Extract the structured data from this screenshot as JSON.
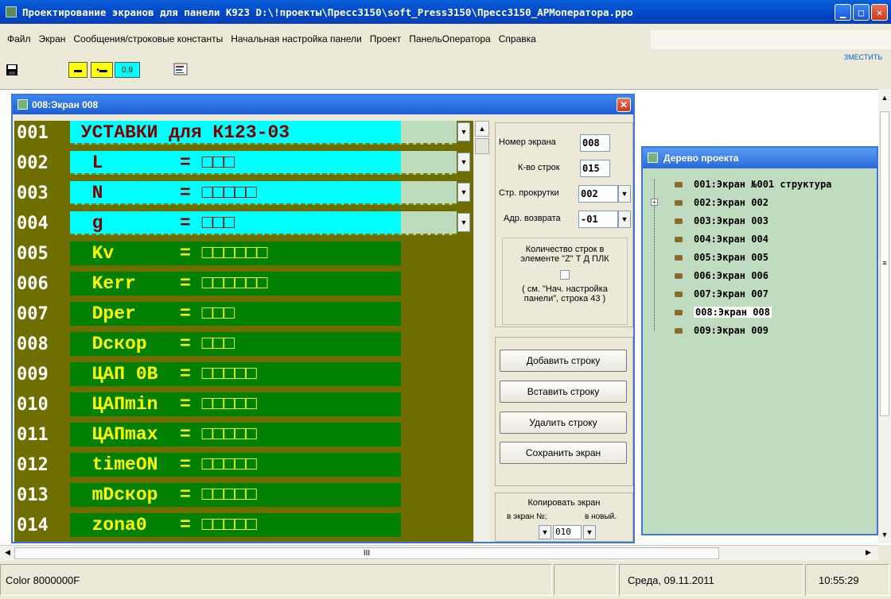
{
  "window": {
    "title": "Проектирование экранов для панели К923  D:\\!проекты\\Пресс3150\\soft_Press3150\\Пресс3150_АРМоператора.ppo"
  },
  "menu": [
    "Файл",
    "Экран",
    "Сообщения/строковые константы",
    "Начальная настройка панели",
    "Проект",
    "ПанельОператора",
    "Справка"
  ],
  "toolbar": {
    "zoom": "0.9"
  },
  "screen_window": {
    "title": "008:Экран 008"
  },
  "rows": [
    {
      "num": "001",
      "text": " УСТАВКИ для К123-03",
      "style": "cyan"
    },
    {
      "num": "002",
      "text": "  L       = □□□",
      "style": "cyan"
    },
    {
      "num": "003",
      "text": "  N       = □□□□□",
      "style": "cyan"
    },
    {
      "num": "004",
      "text": "  g       = □□□",
      "style": "cyan"
    },
    {
      "num": "005",
      "text": "  Kv      = □□□□□□",
      "style": "green"
    },
    {
      "num": "006",
      "text": "  Kerr    = □□□□□□",
      "style": "green"
    },
    {
      "num": "007",
      "text": "  Dper    = □□□",
      "style": "green"
    },
    {
      "num": "008",
      "text": "  Dскор   = □□□",
      "style": "green"
    },
    {
      "num": "009",
      "text": "  ЦАП 0B  = □□□□□",
      "style": "green"
    },
    {
      "num": "010",
      "text": "  ЦАПmin  = □□□□□",
      "style": "green"
    },
    {
      "num": "011",
      "text": "  ЦАПmax  = □□□□□",
      "style": "green"
    },
    {
      "num": "012",
      "text": "  timeON  = □□□□□",
      "style": "green"
    },
    {
      "num": "013",
      "text": "  mDскор  = □□□□□",
      "style": "green"
    },
    {
      "num": "014",
      "text": "  zona0   = □□□□□",
      "style": "green"
    }
  ],
  "props": {
    "screen_num_label": "Номер экрана",
    "screen_num": "008",
    "rows_label": "К-во строк",
    "rows": "015",
    "scroll_label": "Стр. прокрутки",
    "scroll": "002",
    "return_label": "Адр. возврата",
    "return": "-01",
    "plc_text": [
      "Количество строк в",
      "элементе \"Z\" Т Д ПЛК",
      "( см. \"Нач. настройка",
      "панели\", строка 43 )"
    ]
  },
  "buttons": {
    "add": "Добавить строку",
    "insert": "Вставить строку",
    "delete": "Удалить строку",
    "save": "Сохранить экран"
  },
  "copy": {
    "title": "Копировать экран",
    "to_screen": "в экран №;",
    "to_new": "в новый.",
    "value": "010"
  },
  "tree": {
    "title": "Дерево проекта",
    "items": [
      "001:Экран №001 структура",
      "002:Экран 002",
      "003:Экран 003",
      "004:Экран 004",
      "005:Экран 005",
      "006:Экран 006",
      "007:Экран 007",
      "008:Экран 008",
      "009:Экран 009"
    ],
    "selected_index": 7
  },
  "hscroll_marker": "III",
  "status": {
    "color": "Color 8000000F",
    "date": "Среда, 09.11.2011",
    "time": "10:55:29"
  },
  "top_right_fragment": "ЗМЕСТИТЬ"
}
